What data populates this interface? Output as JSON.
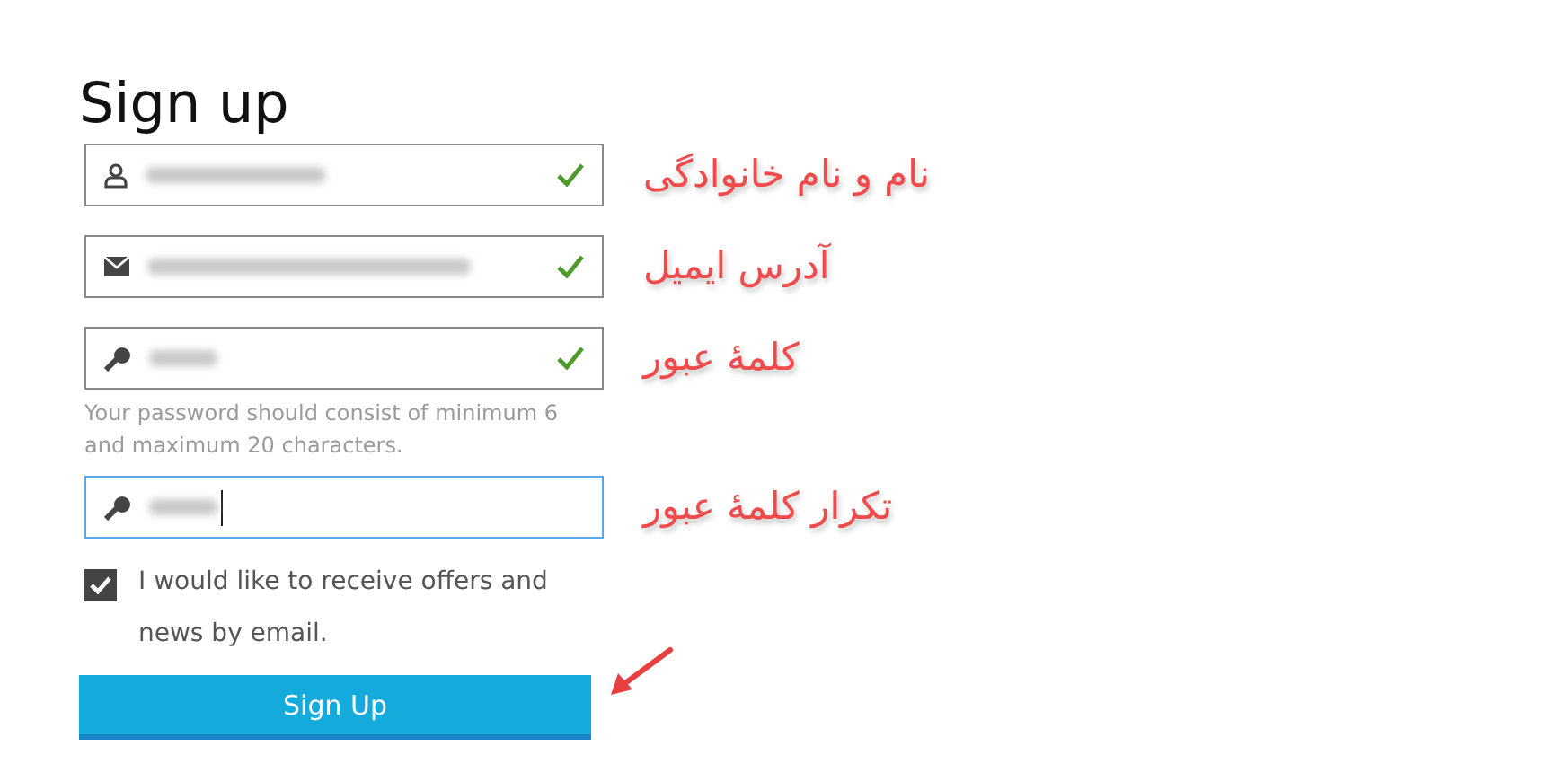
{
  "title": "Sign up",
  "fields": [
    {
      "kind": "user",
      "valid": true,
      "focused": false,
      "annotation": "نام و نام خانوادگی"
    },
    {
      "kind": "email",
      "valid": true,
      "focused": false,
      "annotation": "آدرس ایمیل"
    },
    {
      "kind": "password",
      "valid": true,
      "focused": false,
      "annotation": "کلمهٔ عبور",
      "hint": "Your password should consist of minimum 6 and maximum 20 characters."
    },
    {
      "kind": "password",
      "valid": false,
      "focused": true,
      "annotation": "تکرار کلمهٔ عبور"
    }
  ],
  "newsletter": {
    "label": "I would like to receive offers and news by email.",
    "checked": true
  },
  "button": "Sign Up"
}
